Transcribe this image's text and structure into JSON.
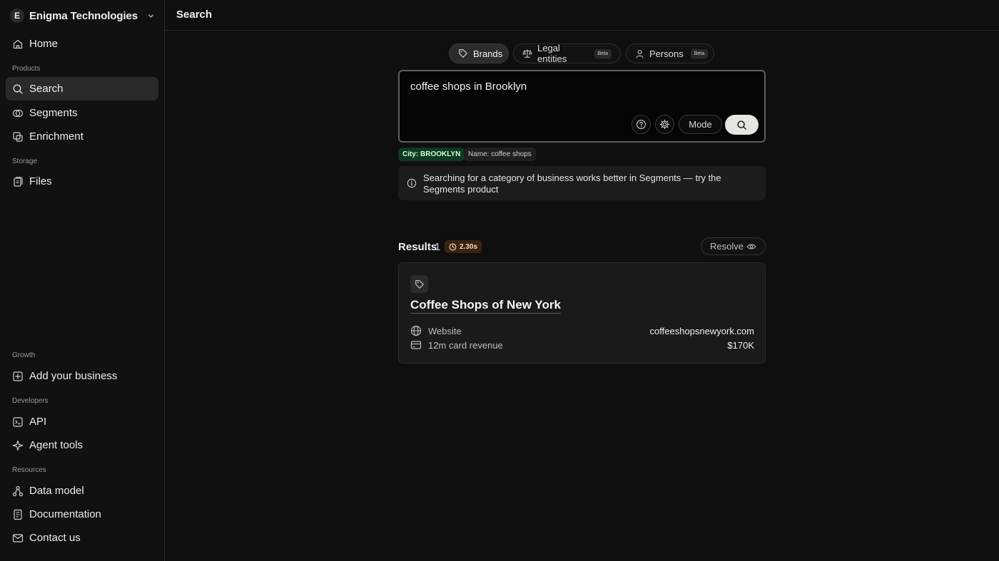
{
  "org": {
    "initial": "E",
    "name": "Enigma Technologies"
  },
  "sidebar": {
    "home": "Home",
    "sections": {
      "products": "Products",
      "storage": "Storage",
      "growth": "Growth",
      "developers": "Developers",
      "resources": "Resources"
    },
    "items": {
      "search": "Search",
      "segments": "Segments",
      "enrichment": "Enrichment",
      "files": "Files",
      "add_business": "Add your business",
      "api": "API",
      "agent_tools": "Agent tools",
      "data_model": "Data model",
      "documentation": "Documentation",
      "contact": "Contact us"
    },
    "active": "search"
  },
  "header": {
    "title": "Search"
  },
  "tabs": [
    {
      "label": "Brands",
      "icon": "tag-icon",
      "active": true
    },
    {
      "label": "Legal entities",
      "icon": "scale-icon",
      "badge": "Beta"
    },
    {
      "label": "Persons",
      "icon": "person-icon",
      "badge": "Beta"
    }
  ],
  "search": {
    "value": "coffee shops in Brooklyn",
    "mode_label": "Mode"
  },
  "filters": {
    "city": "City: BROOKLYN",
    "name": "Name: coffee shops"
  },
  "info": {
    "text": "Searching for a category of business works better in Segments — try the Segments product"
  },
  "results": {
    "label": "Results",
    "count": "1",
    "timing": "2.30s",
    "resolve_label": "Resolve",
    "items": [
      {
        "title": "Coffee Shops of New York",
        "rows": [
          {
            "label": "Website",
            "value": "coffeeshopsnewyork.com",
            "icon": "globe-icon"
          },
          {
            "label": "12m card revenue",
            "value": "$170K",
            "icon": "credit-card-icon"
          }
        ]
      }
    ]
  },
  "colors": {
    "background": "#0f0f0f",
    "city_chip": "#0e3a20",
    "timing_badge": "#3a2410",
    "search_button": "#e7e5e0"
  }
}
